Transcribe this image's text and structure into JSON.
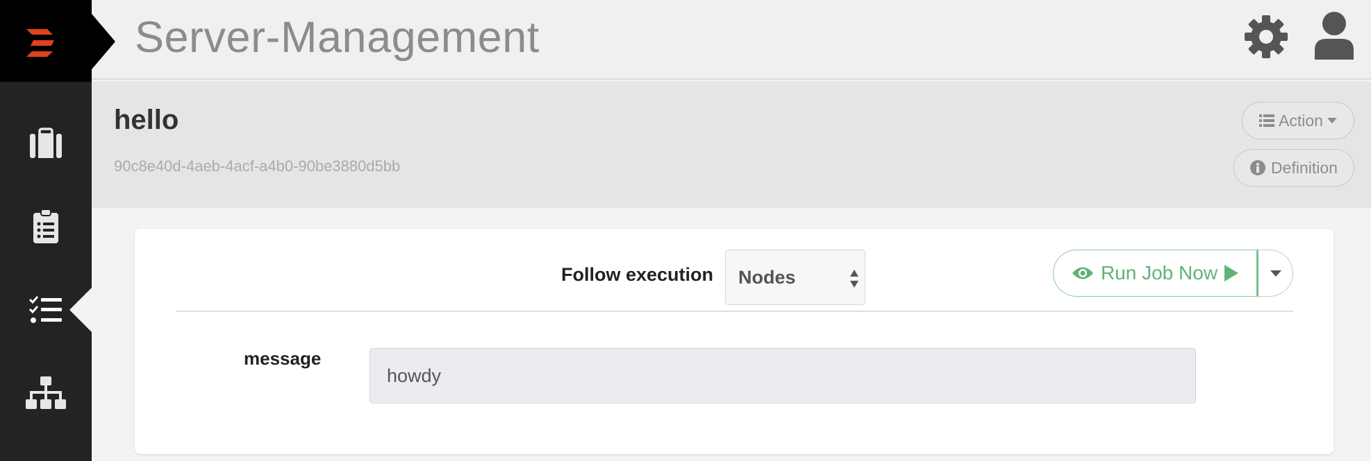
{
  "header": {
    "app_title": "Server-Management"
  },
  "sidebar": {
    "items": [
      {
        "icon": "briefcase-icon",
        "active": false
      },
      {
        "icon": "clipboard-list-icon",
        "active": false
      },
      {
        "icon": "task-list-icon",
        "active": true
      },
      {
        "icon": "sitemap-icon",
        "active": false
      }
    ]
  },
  "job": {
    "name": "hello",
    "uuid": "90c8e40d-4aeb-4acf-a4b0-90be3880d5bb",
    "action_label": "Action",
    "definition_label": "Definition"
  },
  "run_form": {
    "follow_label": "Follow execution",
    "follow_value": "Nodes",
    "run_label": "Run Job Now",
    "option_name": "message",
    "option_value": "howdy"
  },
  "colors": {
    "brand_red": "#e0421c",
    "sidebar_bg": "#232323",
    "run_green": "#5fb377"
  }
}
